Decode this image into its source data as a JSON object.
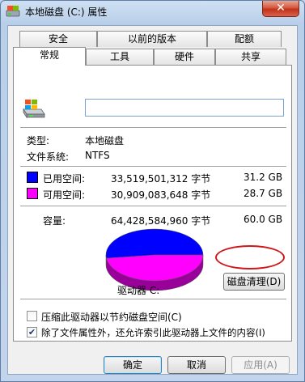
{
  "window": {
    "title": "本地磁盘 (C:) 属性",
    "close_glyph": "✕"
  },
  "tabs_back": [
    "安全",
    "以前的版本",
    "配额"
  ],
  "tabs_front": [
    "常规",
    "工具",
    "硬件",
    "共享"
  ],
  "general": {
    "name_value": "",
    "type_label": "类型:",
    "type_value": "本地磁盘",
    "fs_label": "文件系统:",
    "fs_value": "NTFS",
    "used": {
      "label": "已用空间:",
      "bytes": "33,519,501,312 字节",
      "size": "31.2 GB",
      "color": "#0000ff"
    },
    "free": {
      "label": "可用空间:",
      "bytes": "30,909,083,648 字节",
      "size": "28.7 GB",
      "color": "#ff00ff"
    },
    "capacity": {
      "label": "容量:",
      "bytes": "64,428,584,960 字节",
      "size": "60.0 GB"
    },
    "drive_label": "驱动器 C:",
    "cleanup_button": "磁盘清理(D)",
    "compress_checkbox": {
      "label": "压缩此驱动器以节约磁盘空间(C)",
      "checked": false
    },
    "index_checkbox": {
      "label": "除了文件属性外，还允许索引此驱动器上文件的内容(I)",
      "checked": true
    }
  },
  "buttons": {
    "ok": "确定",
    "cancel": "取消",
    "apply": "应用(A)"
  },
  "chart_data": {
    "type": "pie",
    "categories": [
      "已用空间",
      "可用空间"
    ],
    "values": [
      33519501312,
      30909083648
    ],
    "colors": [
      "#0000ff",
      "#ff00ff"
    ]
  }
}
